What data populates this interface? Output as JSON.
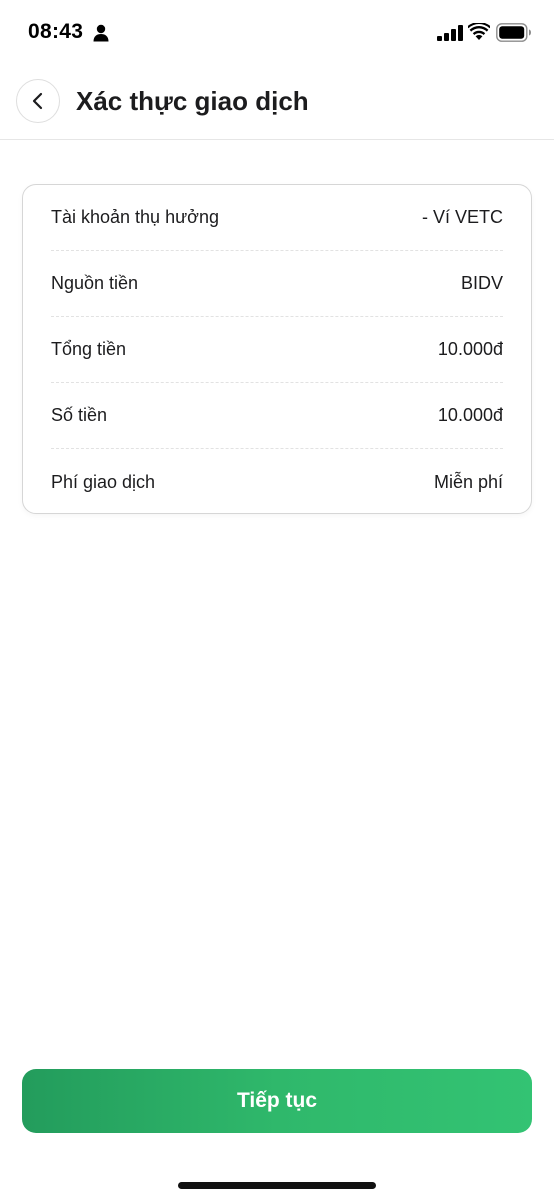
{
  "status_bar": {
    "time": "08:43"
  },
  "header": {
    "title": "Xác thực giao dịch"
  },
  "details": [
    {
      "label": "Tài khoản thụ hưởng",
      "value": "- Ví VETC"
    },
    {
      "label": "Nguồn tiền",
      "value": "BIDV"
    },
    {
      "label": "Tổng tiền",
      "value": "10.000đ"
    },
    {
      "label": "Số tiền",
      "value": "10.000đ"
    },
    {
      "label": "Phí giao dịch",
      "value": "Miễn phí"
    }
  ],
  "actions": {
    "continue_label": "Tiếp tục"
  },
  "icons": {
    "back": "chevron-left-icon",
    "status": [
      "person-icon",
      "signal-icon",
      "wifi-icon",
      "battery-icon"
    ]
  },
  "colors": {
    "primary_start": "#239c5c",
    "primary_end": "#33c373",
    "text": "#1c1c1e",
    "card_border": "#d6d6d6"
  }
}
